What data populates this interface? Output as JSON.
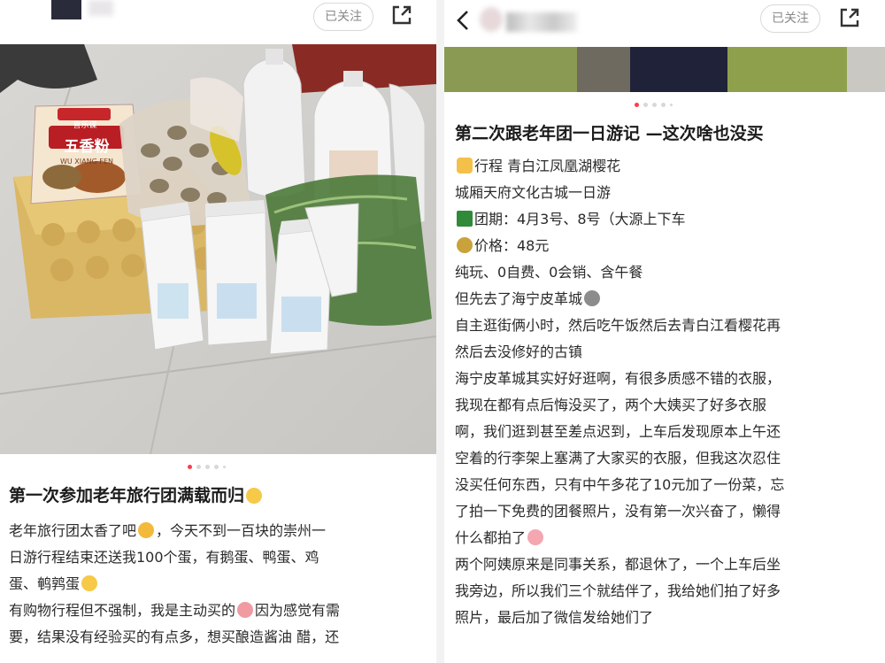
{
  "left": {
    "follow_label": "已关注",
    "package_brand": "喜乐谋",
    "package_title": "五香粉",
    "package_sub": "WU XIANG FEN",
    "title": "第一次参加老年旅行团满载而归",
    "body_lines": [
      "老年旅行团太香了吧",
      "，今天不到一百块的崇州一",
      "日游行程结束还送我100个蛋，有鹅蛋、鸭蛋、鸡",
      "蛋、鹌鹑蛋",
      "有购物行程但不强制，我是主动买的",
      "因为感觉有需",
      "要，结果没有经验买的有点多，想买酿造酱油 醋，还"
    ],
    "dots_count": 5
  },
  "right": {
    "back_icon": "chevron-left-icon",
    "follow_label": "已关注",
    "title": "第二次跟老年团一日游记 —这次啥也没买",
    "body_lines": [
      "行程 青白江凤凰湖樱花",
      "城厢天府文化古城一日游",
      "团期：4月3号、8号（大源上下车",
      "价格：48元",
      "纯玩、0自费、0会销、含午餐",
      "但先去了海宁皮革城",
      "自主逛街俩小时，然后吃午饭然后去青白江看樱花再",
      "然后去没修好的古镇",
      "海宁皮革城其实好好逛啊，有很多质感不错的衣服，",
      "我现在都有点后悔没买了，两个大姨买了好多衣服",
      "啊，我们逛到甚至差点迟到，上车后发现原本上午还",
      "空着的行李架上塞满了大家买的衣服，但我这次忍住",
      "没买任何东西，只有中午多花了10元加了一份菜，忘",
      "了拍一下免费的团餐照片，没有第一次兴奋了，懒得",
      "什么都拍了",
      "两个阿姨原来是同事关系，都退休了，一个上车后坐",
      "我旁边，所以我们三个就结伴了，我给她们拍了好多",
      "照片，最后加了微信发给她们了"
    ],
    "dots_count": 5
  },
  "colors": {
    "accent": "#ff3b4d",
    "text": "#222222",
    "muted": "#888888"
  },
  "icons": [
    "share-icon",
    "chevron-left-icon",
    "pointing-hand-icon",
    "tree-icon",
    "money-bag-icon",
    "emoji-icon"
  ]
}
